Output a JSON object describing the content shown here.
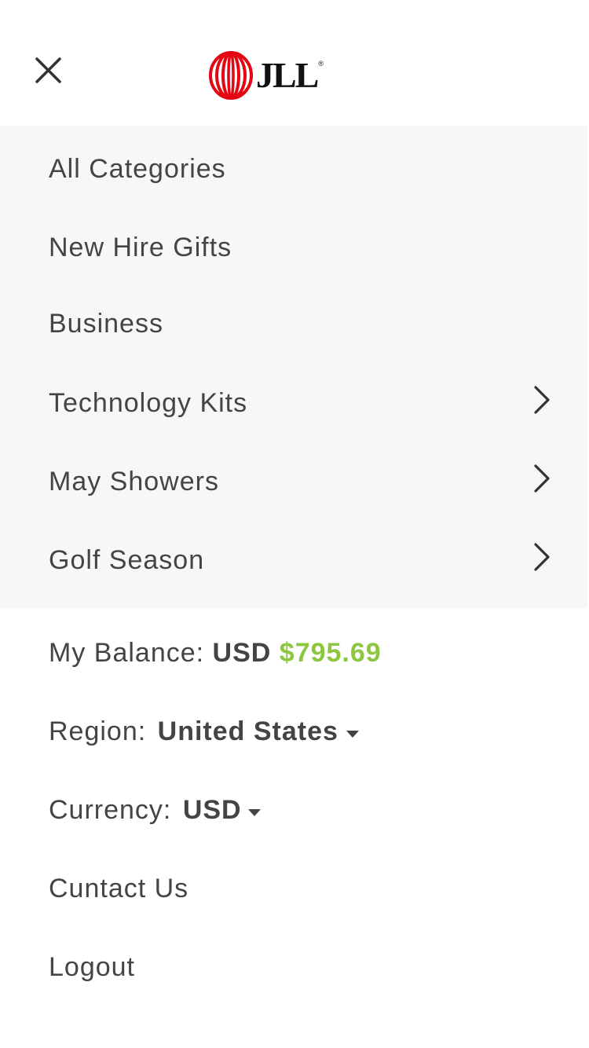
{
  "header": {
    "close_icon": "close-icon",
    "logo": {
      "text": "JLL",
      "registered": "®",
      "brand_color": "#e30613"
    }
  },
  "menu": {
    "categories": [
      {
        "label": "All Categories",
        "has_submenu": false
      },
      {
        "label": "New Hire Gifts",
        "has_submenu": false
      },
      {
        "label": "Business",
        "has_submenu": false
      },
      {
        "label": "Technology Kits",
        "has_submenu": true
      },
      {
        "label": "May Showers",
        "has_submenu": true
      },
      {
        "label": "Golf Season",
        "has_submenu": true
      }
    ],
    "chevron_icon": "chevron-right-icon"
  },
  "account": {
    "balance": {
      "label": "My Balance:",
      "currency": "USD",
      "amount": "$795.69",
      "amount_color": "#8dc63f"
    },
    "region": {
      "label": "Region:",
      "value": "United States"
    },
    "currency": {
      "label": "Currency:",
      "value": "USD"
    },
    "contact_label": "Cuntact Us",
    "logout_label": "Logout"
  },
  "colors": {
    "text": "#444444",
    "menu_background": "#f7f7f7",
    "page_background": "#ffffff"
  }
}
